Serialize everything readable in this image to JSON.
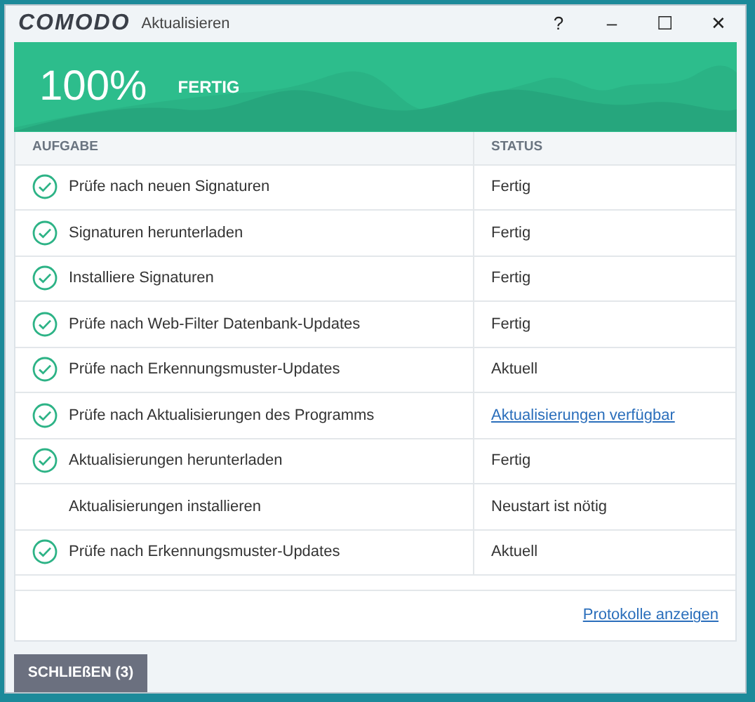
{
  "window": {
    "logo": "COMODO",
    "title": "Aktualisieren",
    "controls": [
      "?",
      "–",
      "☐",
      "✕"
    ]
  },
  "banner": {
    "percent": "100%",
    "status": "FERTIG"
  },
  "table": {
    "columns": [
      "AUFGABE",
      "STATUS"
    ],
    "rows": [
      {
        "kind": "text",
        "task": "Prüfe nach neuen Signaturen",
        "status": "Fertig",
        "done": true
      },
      {
        "kind": "text",
        "task": "Signaturen herunterladen",
        "status": "Fertig",
        "done": true
      },
      {
        "kind": "text",
        "task": "Installiere Signaturen",
        "status": "Fertig",
        "done": true
      },
      {
        "kind": "text",
        "task": "Prüfe nach Web-Filter Datenbank-Updates",
        "status": "Fertig",
        "done": true
      },
      {
        "kind": "text",
        "task": "Prüfe nach Erkennungsmuster-Updates",
        "status": "Aktuell",
        "done": true
      },
      {
        "kind": "link",
        "task": "Prüfe nach Aktualisierungen des Programms",
        "status": "Aktualisierungen verfügbar",
        "done": true
      },
      {
        "kind": "text",
        "task": "Aktualisierungen herunterladen",
        "status": "Fertig",
        "done": true
      },
      {
        "kind": "text",
        "task": "Aktualisierungen installieren",
        "status": "Neustart ist nötig",
        "done": false
      },
      {
        "kind": "text",
        "task": "Prüfe nach Erkennungsmuster-Updates",
        "status": "Aktuell",
        "done": true
      }
    ]
  },
  "logs_link": "Protokolle anzeigen",
  "close_button": "SCHLIEßEN (3)"
}
